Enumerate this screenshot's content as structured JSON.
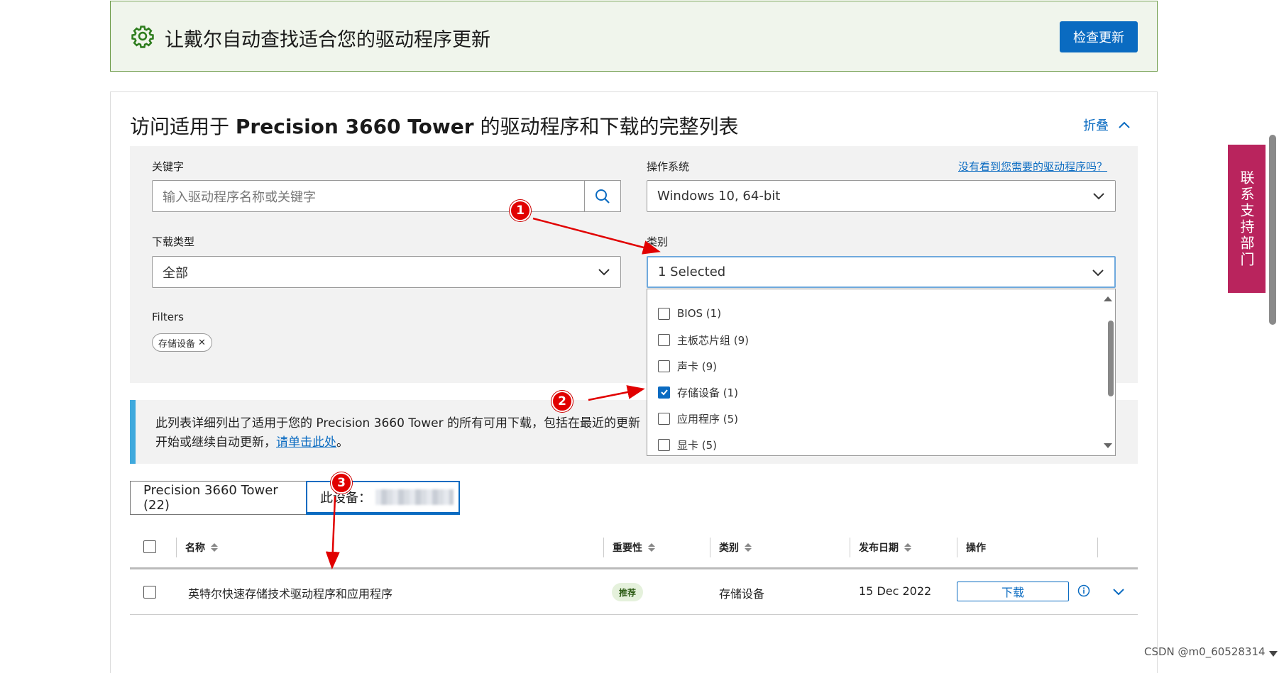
{
  "banner": {
    "title": "让戴尔自动查找适合您的驱动程序更新",
    "button": "检查更新",
    "icon": "gear-icon"
  },
  "card": {
    "title_prefix": "访问适用于 ",
    "title_model": "Precision 3660 Tower",
    "title_suffix": " 的驱动程序和下载的完整列表",
    "collapse_label": "折叠"
  },
  "filters": {
    "keyword_label": "关键字",
    "keyword_placeholder": "输入驱动程序名称或关键字",
    "os_label": "操作系统",
    "os_value": "Windows 10, 64-bit",
    "missing_link": "没有看到您需要的驱动程序吗？",
    "download_type_label": "下载类型",
    "download_type_value": "全部",
    "category_label": "类别",
    "category_value": "1 Selected",
    "filters_label": "Filters",
    "chip": "存储设备"
  },
  "category_options": [
    {
      "label": "BIOS (1)",
      "checked": false
    },
    {
      "label": "主板芯片组 (9)",
      "checked": false
    },
    {
      "label": "声卡 (9)",
      "checked": false
    },
    {
      "label": "存储设备 (1)",
      "checked": true
    },
    {
      "label": "应用程序 (5)",
      "checked": false
    },
    {
      "label": "显卡 (5)",
      "checked": false
    }
  ],
  "info": {
    "line1": "此列表详细列出了适用于您的 Precision 3660 Tower 的所有可用下载，包括在最近的更新",
    "line2_prefix": "开始或继续自动更新，",
    "link": "请单击此处",
    "line2_suffix": "。"
  },
  "tabs": [
    {
      "label": "Precision 3660 Tower (22)"
    },
    {
      "label": "此设备："
    }
  ],
  "table": {
    "headers": {
      "name": "名称",
      "importance": "重要性",
      "category": "类别",
      "date": "发布日期",
      "action": "操作"
    },
    "rows": [
      {
        "name": "英特尔快速存储技术驱动程序和应用程序",
        "importance": "推荐",
        "category": "存储设备",
        "date": "15 Dec 2022",
        "action": "下载"
      }
    ]
  },
  "sidebar_support": "联系支持部门",
  "markers": [
    "1",
    "2",
    "3"
  ],
  "watermark": "CSDN @m0_60528314",
  "colors": {
    "accent": "#0a6bc1",
    "banner_bg": "#f0f5ec",
    "support": "#b9245d",
    "annotation": "#e10000"
  }
}
